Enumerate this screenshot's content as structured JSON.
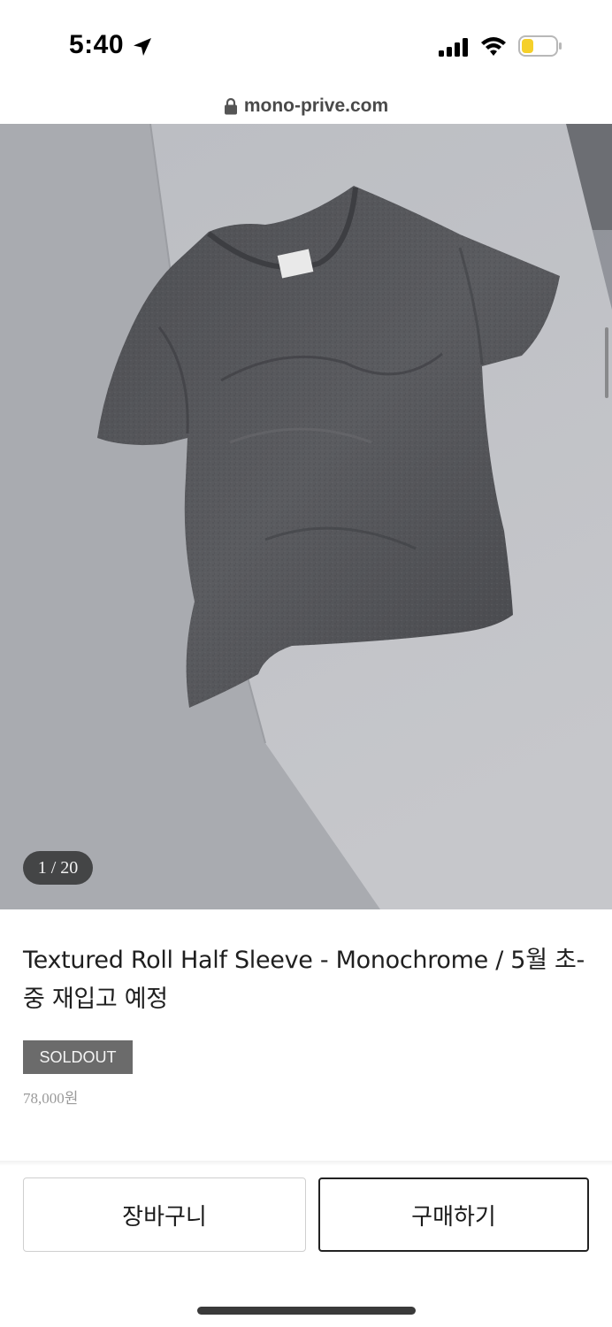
{
  "status_bar": {
    "time": "5:40",
    "icons": [
      "location-arrow-icon",
      "cellular-signal-icon",
      "wifi-icon",
      "battery-low-icon"
    ],
    "battery_color": "#f5d02a"
  },
  "browser": {
    "url": "mono-prive.com"
  },
  "gallery": {
    "counter": "1 / 20"
  },
  "product": {
    "title": "Textured Roll Half Sleeve - Monochrome / 5월 초-중 재입고 예정",
    "status_badge": "SOLDOUT",
    "price": "78,000원"
  },
  "actions": {
    "cart_label": "장바구니",
    "buy_label": "구매하기"
  },
  "colors": {
    "badge_bg": "#6b6b6b",
    "buy_border": "#222222"
  }
}
